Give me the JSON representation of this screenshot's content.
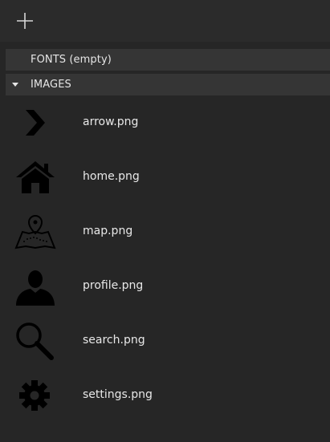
{
  "toolbar": {
    "add_icon": "plus-icon"
  },
  "sections": {
    "fonts_label": "FONTS (empty)",
    "images_label": "IMAGES"
  },
  "images": [
    {
      "name": "arrow.png",
      "icon": "arrow-icon"
    },
    {
      "name": "home.png",
      "icon": "home-icon"
    },
    {
      "name": "map.png",
      "icon": "map-icon"
    },
    {
      "name": "profile.png",
      "icon": "profile-icon"
    },
    {
      "name": "search.png",
      "icon": "search-icon"
    },
    {
      "name": "settings.png",
      "icon": "settings-icon"
    }
  ],
  "colors": {
    "background": "#262626",
    "toolbar": "#2b2b2b",
    "section_header": "#353535",
    "text": "#e8e8e8",
    "icon_fill": "#000000"
  }
}
